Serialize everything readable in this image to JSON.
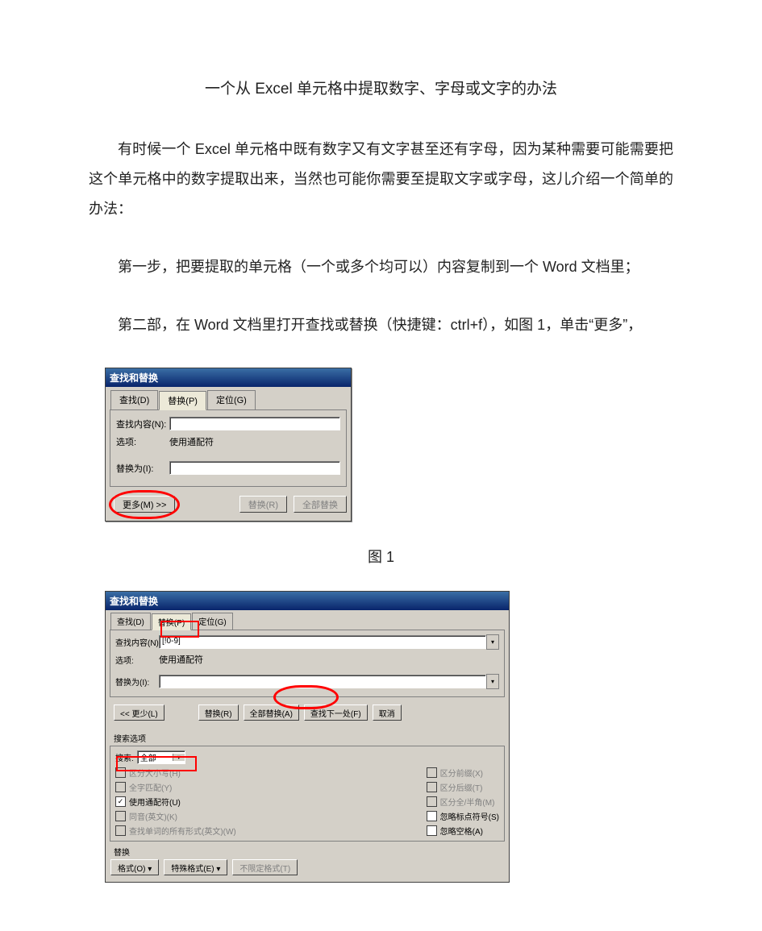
{
  "title": "一个从 Excel 单元格中提取数字、字母或文字的办法",
  "para1": "有时候一个 Excel 单元格中既有数字又有文字甚至还有字母，因为某种需要可能需要把这个单元格中的数字提取出来，当然也可能你需要至提取文字或字母，这儿介绍一个简单的办法：",
  "para2": "第一步，把要提取的单元格（一个或多个均可以）内容复制到一个 Word 文档里；",
  "para3": "第二部，在 Word 文档里打开查找或替换（快捷键：ctrl+f），如图 1，单击“更多”，",
  "caption1": "图 1",
  "dlg1": {
    "title": "查找和替换",
    "tab_find": "查找(D)",
    "tab_replace": "替换(P)",
    "tab_goto": "定位(G)",
    "find_label": "查找内容(N):",
    "option_label": "选项:",
    "option_value": "使用通配符",
    "replace_label": "替换为(I):",
    "btn_more": "更多(M) >>",
    "btn_replace": "替换(R)",
    "btn_replace_all": "全部替换"
  },
  "dlg2": {
    "title": "查找和替换",
    "tab_find": "查找(D)",
    "tab_replace": "替换(P)",
    "tab_goto": "定位(G)",
    "find_label": "查找内容(N):",
    "find_value": "[!0-9]",
    "option_label": "选项:",
    "option_value": "使用通配符",
    "replace_label": "替换为(I):",
    "btn_less": "<< 更少(L)",
    "btn_replace": "替换(R)",
    "btn_replace_all": "全部替换(A)",
    "btn_find_next": "查找下一处(F)",
    "btn_cancel": "取消",
    "opts_title": "搜索选项",
    "search_label": "搜索:",
    "search_value": "全部",
    "chk_case": "区分大小写(H)",
    "chk_whole": "全字匹配(Y)",
    "chk_wildcard": "使用通配符(U)",
    "chk_sounds": "同音(英文)(K)",
    "chk_forms": "查找单词的所有形式(英文)(W)",
    "chk_prefix": "区分前缀(X)",
    "chk_suffix": "区分后缀(T)",
    "chk_full": "区分全/半角(M)",
    "chk_punct": "忽略标点符号(S)",
    "chk_space": "忽略空格(A)",
    "rep_title": "替换",
    "btn_format": "格式(O) ▾",
    "btn_special": "特殊格式(E) ▾",
    "btn_noformat": "不限定格式(T)"
  }
}
